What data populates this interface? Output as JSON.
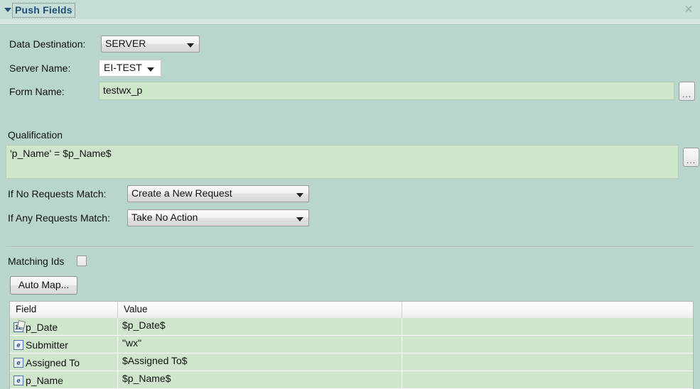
{
  "panel": {
    "title": "Push Fields",
    "disclosure_icon": "triangle-down-icon",
    "close_icon": "close-icon"
  },
  "form": {
    "data_destination": {
      "label": "Data Destination:",
      "value": "SERVER",
      "arrow_icon": "chevron-down-icon"
    },
    "server_name": {
      "label": "Server Name:",
      "value": "EI-TEST",
      "arrow_icon": "chevron-down-icon"
    },
    "form_name": {
      "label": "Form Name:",
      "value": "testwx_p",
      "placeholder": "",
      "browse_label": "..."
    },
    "qualification": {
      "label": "Qualification",
      "value": "'p_Name' = $p_Name$",
      "placeholder": "",
      "browse_label": "..."
    },
    "if_no_requests_match": {
      "label": "If No Requests Match:",
      "value": "Create a New Request",
      "arrow_icon": "chevron-down-icon"
    },
    "if_any_requests_match": {
      "label": "If Any Requests Match:",
      "value": "Take No Action",
      "arrow_icon": "chevron-down-icon"
    },
    "matching_ids": {
      "label": "Matching Ids",
      "checked": false
    },
    "auto_map_button": "Auto Map..."
  },
  "mapping_table": {
    "columns": [
      "Field",
      "Value",
      ""
    ],
    "rows": [
      {
        "icon": "date-field-icon",
        "field": "p_Date",
        "value": "$p_Date$",
        "extra": ""
      },
      {
        "icon": "character-field-icon",
        "field": "Submitter",
        "value": "\"wx\"",
        "extra": ""
      },
      {
        "icon": "character-field-icon",
        "field": "Assigned To",
        "value": "$Assigned To$",
        "extra": ""
      },
      {
        "icon": "character-field-icon",
        "field": "p_Name",
        "value": "$p_Name$",
        "extra": ""
      }
    ],
    "icon_glyphs": {
      "date-field-icon": "12",
      "character-field-icon": "e"
    }
  },
  "colors": {
    "panel_background": "#b8d6ce",
    "header_background": "#c5ddd6",
    "title_text": "#1f4e79",
    "input_background": "#cfe6cc"
  }
}
